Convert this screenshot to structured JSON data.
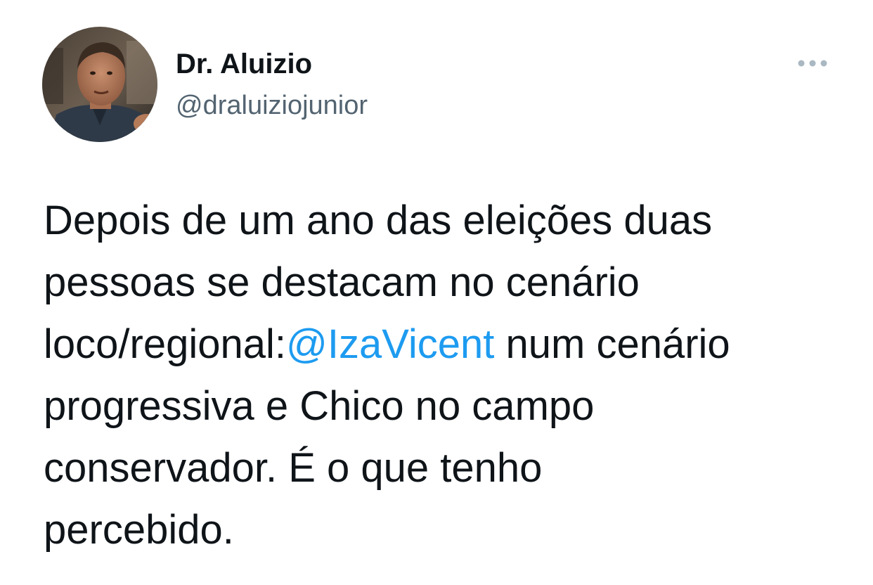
{
  "author": {
    "display_name": "Dr. Aluizio",
    "handle": "@draluiziojunior",
    "avatar_icon": "profile-photo"
  },
  "menu": {
    "icon": "more-horizontal-icon"
  },
  "tweet": {
    "line1": "Depois de um ano das eleições duas",
    "line2": "pessoas se destacam no cenário",
    "line3_prefix": "loco/regional:",
    "mention": "@IzaVicent",
    "line3_suffix": " num cenário",
    "line4": "progressiva e Chico no campo",
    "line5": "conservador. É o que tenho",
    "line6": "percebido."
  },
  "colors": {
    "text": "#0f1419",
    "secondary": "#536471",
    "link": "#1d9bf0",
    "background": "#ffffff"
  }
}
